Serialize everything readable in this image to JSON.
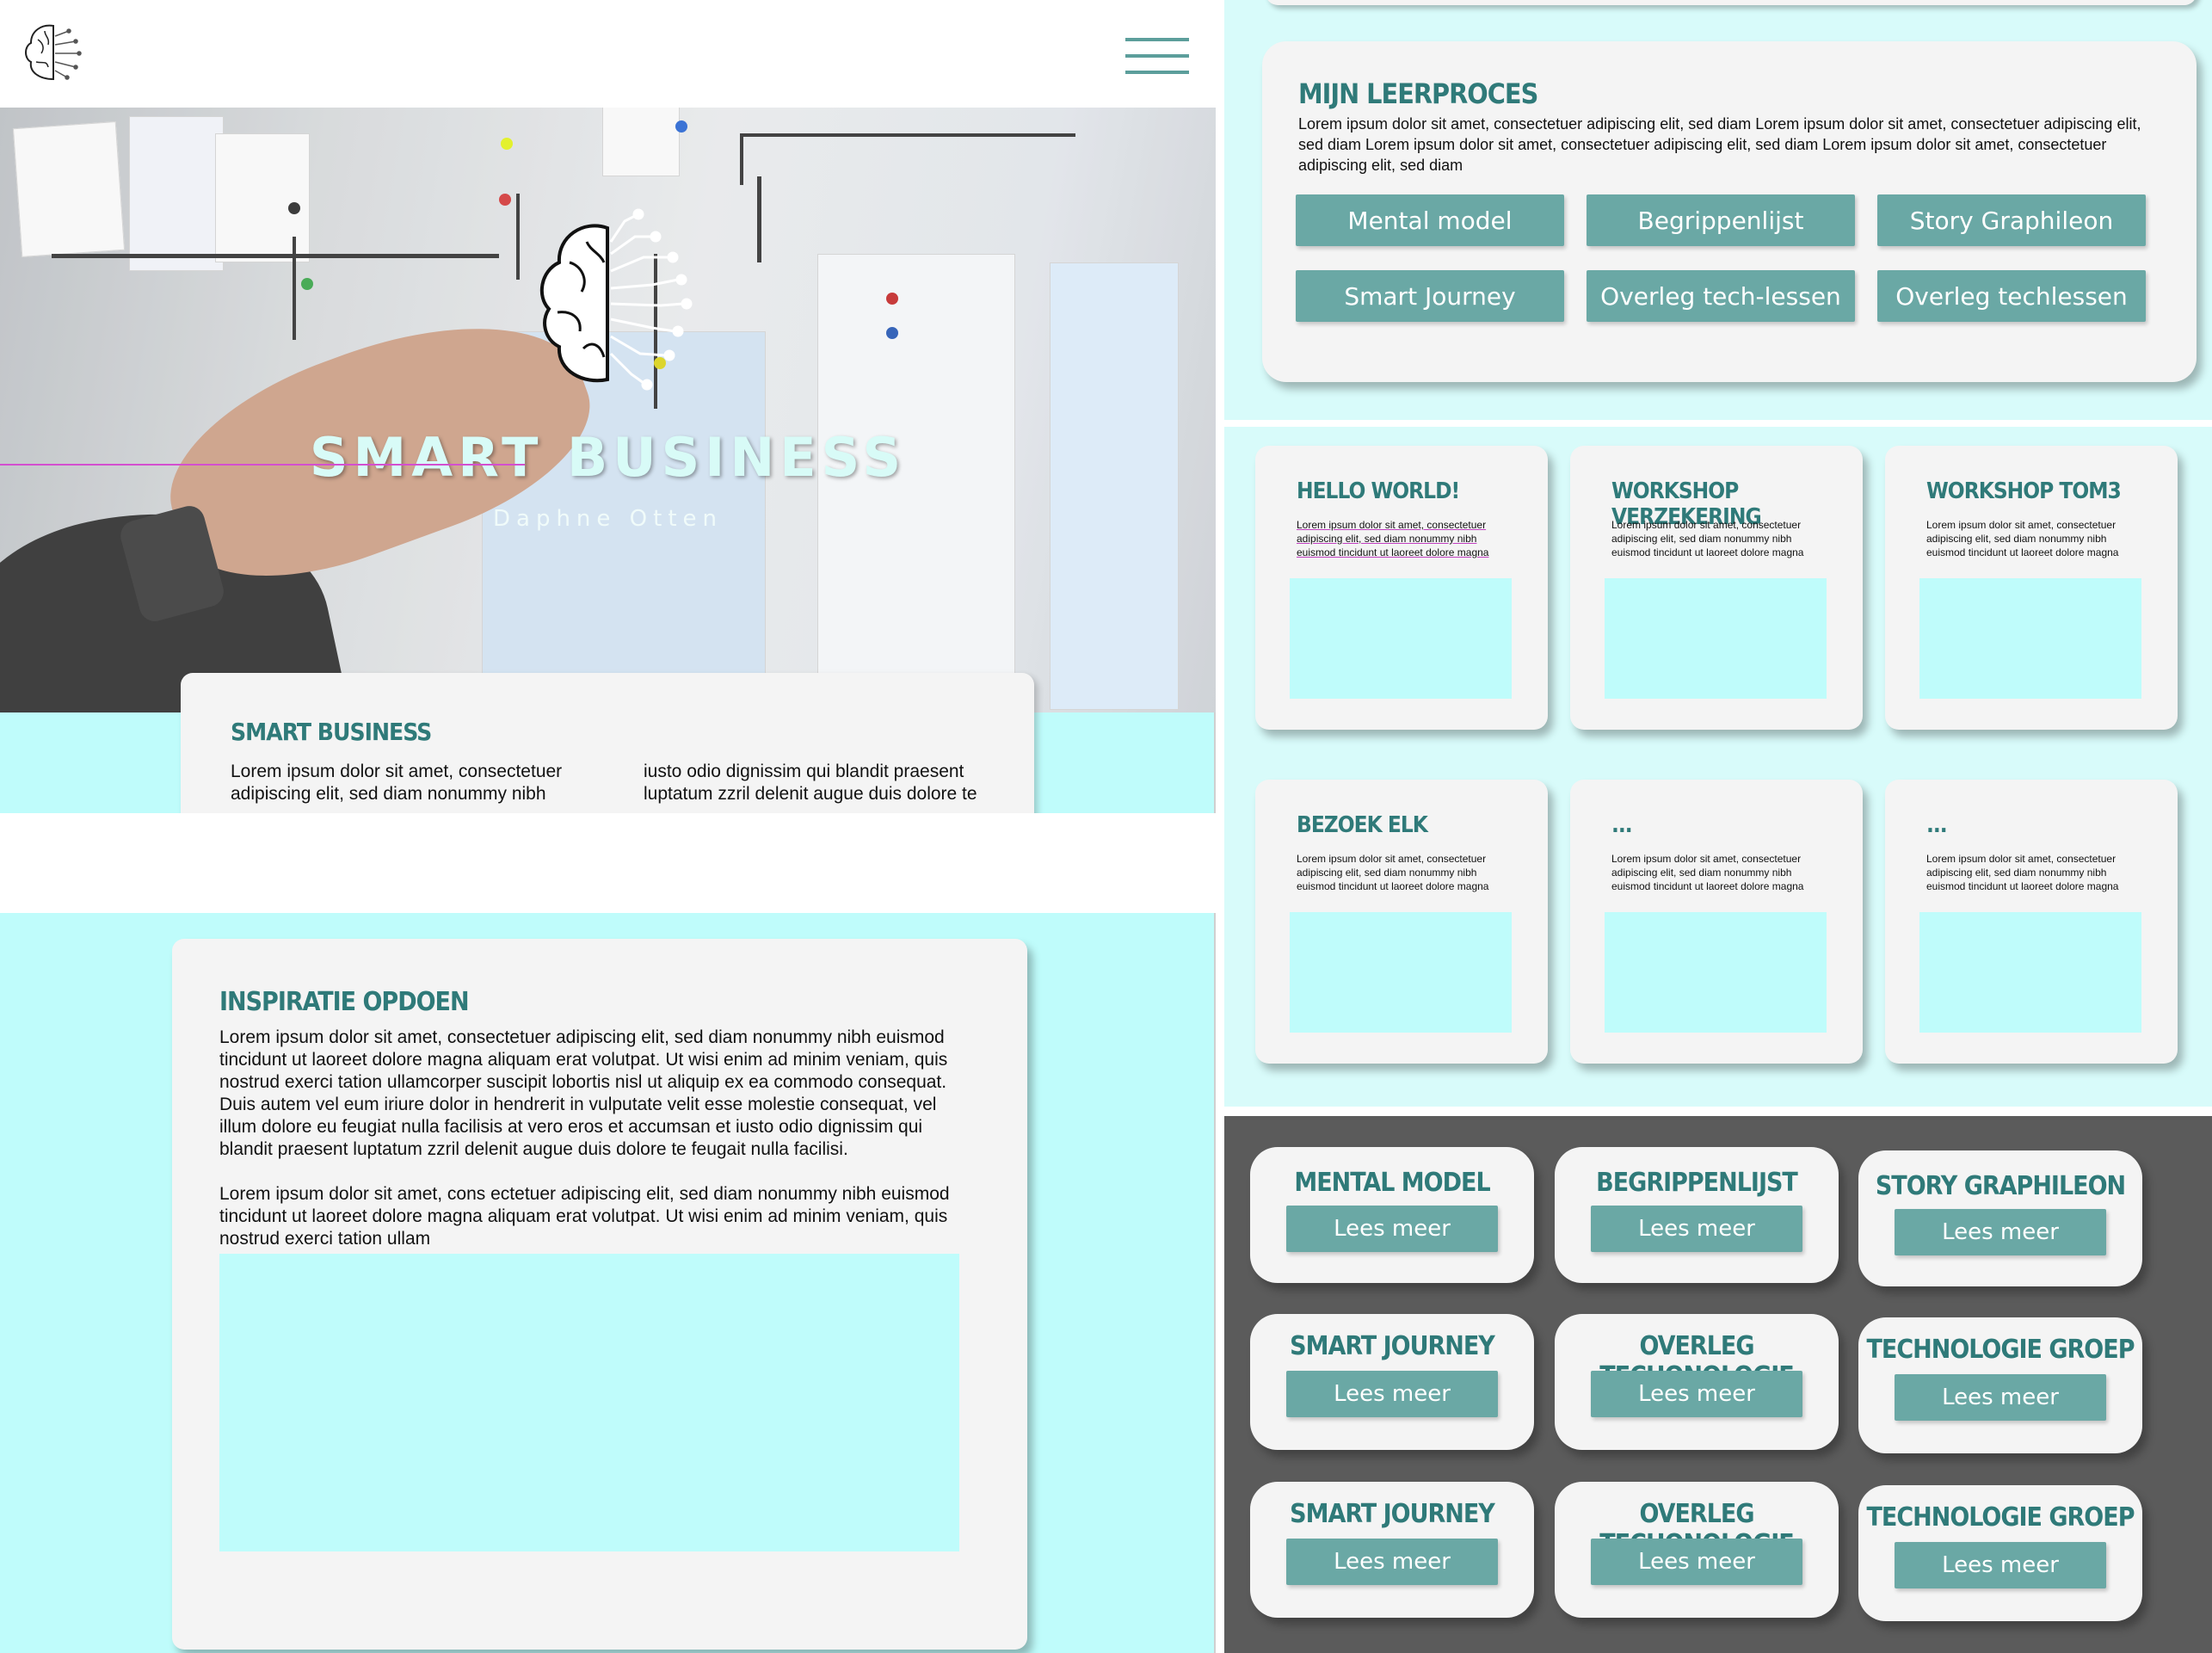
{
  "header": {
    "menu_icon": "hamburger-menu-icon",
    "logo_icon": "brain-circuit-icon"
  },
  "hero": {
    "title": "SMART BUSINESS",
    "subtitle": "Daphne Otten"
  },
  "intro_card": {
    "title": "SMART BUSINESS",
    "col1": "Lorem ipsum dolor sit amet, consectetuer adipiscing elit, sed diam nonummy nibh",
    "col2": "iusto odio dignissim qui blandit praesent luptatum zzril delenit augue duis dolore te"
  },
  "inspiratie": {
    "title": "INSPIRATIE OPDOEN",
    "body": "Lorem ipsum dolor sit amet, consectetuer adipiscing elit, sed diam nonummy nibh euismod tincidunt ut laoreet dolore magna aliquam erat volutpat. Ut wisi enim ad minim veniam, quis nostrud exerci tation ullamcorper suscipit lobortis nisl ut aliquip ex ea commodo consequat. Duis autem vel eum iriure dolor in hendrerit in vulputate velit esse molestie consequat, vel illum dolore eu feugiat nulla facilisis at vero eros et accumsan et iusto odio dignissim qui blandit praesent luptatum zzril delenit augue duis dolore te feugait nulla facilisi.",
    "body2": "Lorem ipsum dolor sit amet, cons ectetuer adipiscing elit, sed diam nonummy nibh euismod tincidunt ut laoreet dolore magna aliquam erat volutpat. Ut wisi enim ad minim veniam, quis nostrud exerci tation ullam"
  },
  "leerproces": {
    "title": "MIJN LEERPROCES",
    "body": "Lorem ipsum dolor sit amet, consectetuer adipiscing elit, sed diam Lorem ipsum dolor sit amet, consectetuer adipiscing elit, sed diam Lorem ipsum dolor sit amet, consectetuer adipiscing elit, sed diam Lorem ipsum dolor sit amet, consectetuer adipiscing elit, sed diam",
    "buttons": [
      "Mental model",
      "Begrippenlijst",
      "Story Graphileon",
      "Smart Journey",
      "Overleg tech-lessen",
      "Overleg techlessen"
    ]
  },
  "blog": {
    "snippet": "Lorem ipsum dolor sit amet, consectetuer adipiscing elit, sed diam nonummy nibh euismod tincidunt ut laoreet dolore magna",
    "cards": [
      "HELLO WORLD!",
      "WORKSHOP VERZEKERING",
      "WORKSHOP TOM3",
      "BEZOEK ELK",
      "...",
      "..."
    ]
  },
  "tiles": {
    "button_label": "Lees meer",
    "titles": [
      "MENTAL MODEL",
      "BEGRIPPENLIJST",
      "STORY GRAPHILEON",
      "SMART JOURNEY",
      "OVERLEG TECHONOLOGIE",
      "TECHNOLOGIE GROEP",
      "SMART JOURNEY",
      "OVERLEG TECHONOLOGIE",
      "TECHNOLOGIE GROEP"
    ]
  },
  "colors": {
    "accent": "#6aa8a5",
    "heading": "#2f7a79",
    "light_cyan": "#bffcfb",
    "dark_panel": "#5b5b5b"
  }
}
